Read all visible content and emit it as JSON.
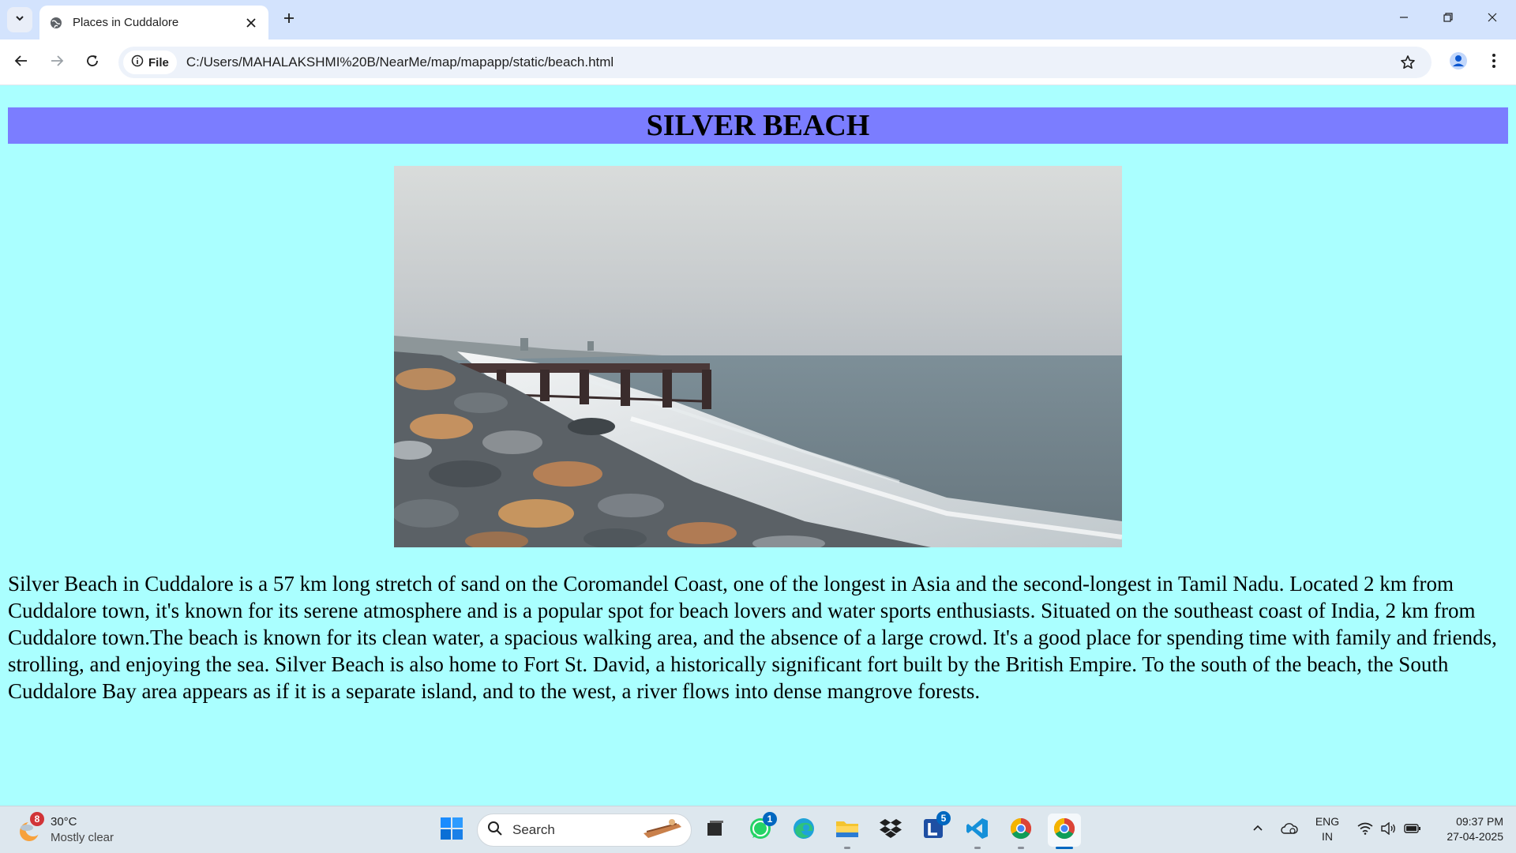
{
  "browser": {
    "tab": {
      "title": "Places in Cuddalore"
    },
    "omnibox": {
      "chip_label": "File",
      "url": "C:/Users/MAHALAKSHMI%20B/NearMe/map/mapapp/static/beach.html"
    }
  },
  "page": {
    "heading": "SILVER BEACH",
    "heading_bg": "#7b7dff",
    "page_bg": "#aaffff",
    "image": {
      "alt": "Silver Beach shoreline with rocks, pier and sea"
    },
    "description": "Silver Beach in Cuddalore is a 57 km long stretch of sand on the Coromandel Coast, one of the longest in Asia and the second-longest in Tamil Nadu. Located 2 km from Cuddalore town, it's known for its serene atmosphere and is a popular spot for beach lovers and water sports enthusiasts. Situated on the southeast coast of India, 2 km from Cuddalore town.The beach is known for its clean water, a spacious walking area, and the absence of a large crowd. It's a good place for spending time with family and friends, strolling, and enjoying the sea. Silver Beach is also home to Fort St. David, a historically significant fort built by the British Empire. To the south of the beach, the South Cuddalore Bay area appears as if it is a separate island, and to the west, a river flows into dense mangrove forests."
  },
  "taskbar": {
    "weather": {
      "temp": "30°C",
      "condition": "Mostly clear",
      "badge": "8"
    },
    "search_label": "Search",
    "whatsapp_badge": "1",
    "teams_badge": "5",
    "language": {
      "line1": "ENG",
      "line2": "IN"
    },
    "clock": {
      "time": "09:37 PM",
      "date": "27-04-2025"
    }
  }
}
